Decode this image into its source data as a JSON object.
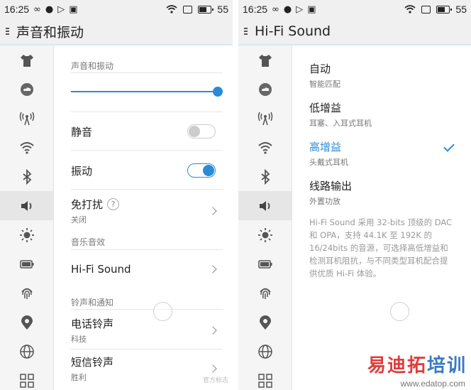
{
  "status_bar": {
    "time": "16:25",
    "battery_level": "55"
  },
  "left": {
    "title": "声音和振动",
    "section_sound": "声音和振动",
    "volume_fraction": 1.0,
    "mute": {
      "label": "静音",
      "on": false
    },
    "vibrate": {
      "label": "振动",
      "on": true
    },
    "dnd": {
      "label": "免打扰",
      "help": "?",
      "sub": "关闭"
    },
    "section_music": "音乐音效",
    "hifi_row": "Hi-Fi Sound",
    "section_ring": "铃声和通知",
    "phone_ringtone": {
      "label": "电话铃声",
      "sub": "科技"
    },
    "sms_ringtone": {
      "label": "短信铃声",
      "sub": "胜利"
    },
    "brand_mark": "官方标志"
  },
  "right": {
    "title": "Hi-Fi Sound",
    "options": [
      {
        "title": "自动",
        "sub": "智能匹配",
        "selected": false
      },
      {
        "title": "低增益",
        "sub": "耳塞、入耳式耳机",
        "selected": false
      },
      {
        "title": "高增益",
        "sub": "头戴式耳机",
        "selected": true
      },
      {
        "title": "线路输出",
        "sub": "外置功放",
        "selected": false
      }
    ],
    "description": "Hi-Fi Sound 采用 32-bits 顶级的 DAC 和 OPA，支持 44.1K 至 192K 的 16/24bits 的音源，可选择高低增益和检测耳机阻抗，与不同类型耳机配合提供优质 Hi-Fi 体验。"
  },
  "side_nav_icons": [
    "theme-shirt-icon",
    "cloud-icon",
    "hotspot-icon",
    "wifi-icon",
    "bluetooth-icon",
    "sound-icon",
    "brightness-icon",
    "battery-icon",
    "fingerprint-icon",
    "location-icon",
    "globe-icon",
    "apps-grid-icon"
  ],
  "watermark": {
    "text_red": "易迪拓",
    "text_blue": "培训",
    "url": "www.edatop.com"
  },
  "colors": {
    "accent": "#2a8bd8",
    "bar": "#f0f0f0"
  }
}
